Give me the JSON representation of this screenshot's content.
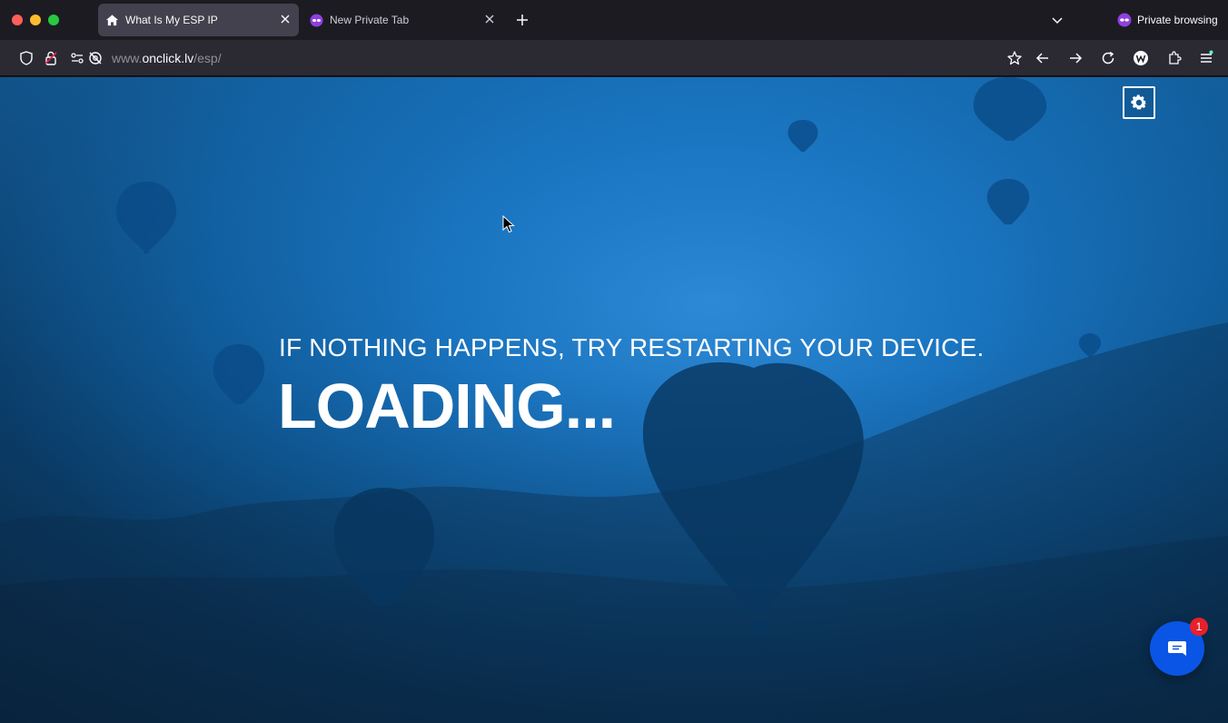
{
  "window": {
    "tabs": [
      {
        "title": "What Is My ESP IP",
        "icon": "home-icon",
        "active": true
      },
      {
        "title": "New Private Tab",
        "icon": "private-mask-icon",
        "active": false
      }
    ],
    "private_label": "Private browsing"
  },
  "address_bar": {
    "prefix": "www.",
    "host": "onclick.lv",
    "path": "/esp/"
  },
  "page": {
    "subtitle": "IF NOTHING HAPPENS, TRY RESTARTING YOUR DEVICE.",
    "title": "LOADING...",
    "chat_badge_count": "1"
  },
  "colors": {
    "accent_chat": "#0a55e6",
    "badge": "#e8202a",
    "private_purple": "#8f3fe0"
  }
}
